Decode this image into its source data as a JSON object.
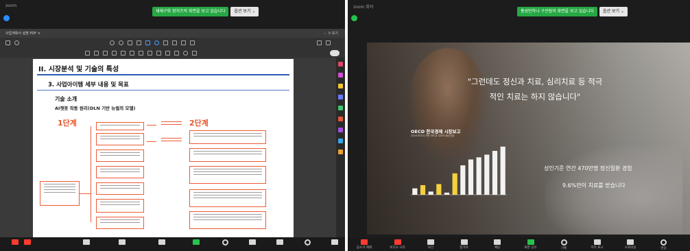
{
  "left_pane": {
    "app_title": "zoom",
    "banner": {
      "message": "재재구희 정치즈의 화면을 보고 있습니다",
      "button": "옵션 보기 ⌄"
    },
    "pdf": {
      "tab_title": "사업계획서 설명 PDF  ×",
      "top_right": "⋯  ⚲  보기"
    },
    "document": {
      "h1": "II. 시장분석 및 기술의 특성",
      "h2": "3. 사업아이템 세부 내용 및 목표",
      "h3": "기술 소개",
      "sub": "AI챗봇 작동 원리(DLN 기반 뉴럴의 모델)",
      "step1": "1단계",
      "step2": "2단계"
    }
  },
  "right_pane": {
    "app_title": "zoom 회의",
    "banner": {
      "message": "홍성민하나 구관점의 화면을 보고 있습니다",
      "button": "옵션 보기 ⌄"
    },
    "slide": {
      "quote": "\"그런데도 정신과 치료, 심리치료 등 적극적인 치료는 하지 않습니다\"",
      "chart_title": "OECD 한국경제 시장보고",
      "chart_sub": "2016 보고서 기반 OECD 주요국 정신건강",
      "stat1": "성인기준 연간 470만명 정신질환 경험",
      "stat2": "9.6%만이 치료를 받습니다"
    }
  },
  "meeting_bar_right": [
    {
      "icon": "mic-muted-icon",
      "label": "음소거 해제",
      "color": "red"
    },
    {
      "icon": "video-off-icon",
      "label": "비디오 시작",
      "color": "red"
    },
    {
      "icon": "security-icon",
      "label": "보안",
      "color": "normal"
    },
    {
      "icon": "participants-icon",
      "label": "참가자",
      "color": "normal"
    },
    {
      "icon": "chat-icon",
      "label": "채팅",
      "color": "normal"
    },
    {
      "icon": "share-screen-icon",
      "label": "화면 공유",
      "color": "green"
    },
    {
      "icon": "record-icon",
      "label": "기록",
      "color": "normal"
    },
    {
      "icon": "caption-icon",
      "label": "자막 표시",
      "color": "normal"
    },
    {
      "icon": "apps-icon",
      "label": "소회의실",
      "color": "normal"
    },
    {
      "icon": "reactions-icon",
      "label": "반응",
      "color": "normal"
    }
  ],
  "chart_data": {
    "type": "bar",
    "title": "OECD 한국경제 시장보고",
    "categories": [
      "",
      "",
      "",
      "",
      "",
      "",
      "",
      "",
      "",
      "",
      "",
      ""
    ],
    "values": [
      12,
      18,
      6,
      20,
      4,
      40,
      55,
      66,
      70,
      75,
      82,
      90
    ],
    "highlight": [
      false,
      true,
      false,
      true,
      false,
      true,
      false,
      false,
      false,
      false,
      false,
      false
    ],
    "ylim": [
      0,
      100
    ],
    "grid": false
  },
  "colors": {
    "accent_blue": "#2a5db0",
    "flow_orange": "#ec5a33",
    "banner_green": "#27a844",
    "bar_white": "#f2f2f2",
    "bar_yellow": "#f4d03f"
  }
}
